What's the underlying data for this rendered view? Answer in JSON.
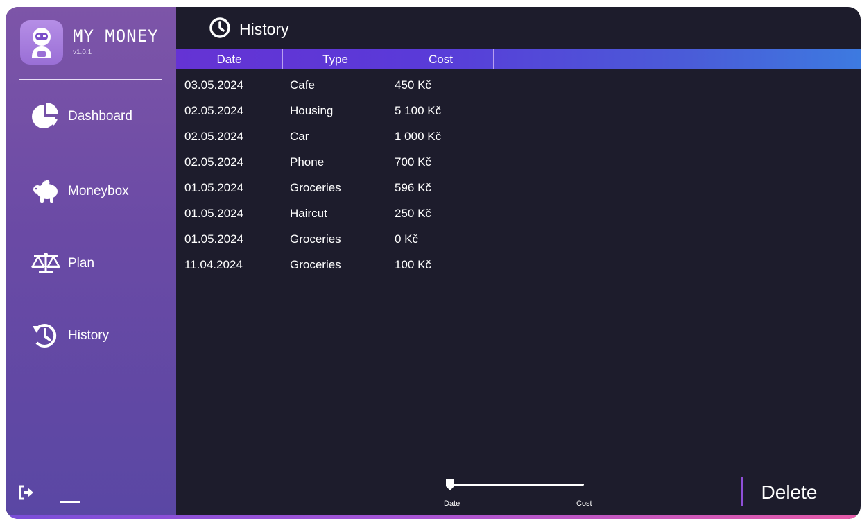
{
  "app": {
    "title": "MY MONEY",
    "version": "v1.0.1",
    "logo_icon": "robot-icon"
  },
  "sidebar": {
    "items": [
      {
        "label": "Dashboard",
        "icon": "pie-chart-icon"
      },
      {
        "label": "Moneybox",
        "icon": "piggy-bank-icon"
      },
      {
        "label": "Plan",
        "icon": "scale-icon"
      },
      {
        "label": "History",
        "icon": "history-icon"
      }
    ],
    "footer_icons": [
      "logout-icon",
      "minimize-icon"
    ]
  },
  "page": {
    "title": "History",
    "icon": "clock-icon"
  },
  "table": {
    "columns": [
      "Date",
      "Type",
      "Cost"
    ],
    "rows": [
      {
        "date": "03.05.2024",
        "type": "Cafe",
        "cost": "450 Kč"
      },
      {
        "date": "02.05.2024",
        "type": "Housing",
        "cost": "5 100 Kč"
      },
      {
        "date": "02.05.2024",
        "type": "Car",
        "cost": "1 000 Kč"
      },
      {
        "date": "02.05.2024",
        "type": "Phone",
        "cost": "700 Kč"
      },
      {
        "date": "01.05.2024",
        "type": "Groceries",
        "cost": "596 Kč"
      },
      {
        "date": "01.05.2024",
        "type": "Haircut",
        "cost": "250 Kč"
      },
      {
        "date": "01.05.2024",
        "type": "Groceries",
        "cost": "0 Kč"
      },
      {
        "date": "11.04.2024",
        "type": "Groceries",
        "cost": "100 Kč"
      }
    ]
  },
  "sort_slider": {
    "labels": [
      "Date",
      "Cost"
    ],
    "selected": "Date"
  },
  "actions": {
    "delete_label": "Delete"
  },
  "colors": {
    "background": "#1d1c2c",
    "sidebar_top": "#7d55a8",
    "sidebar_bottom": "#5a47a4",
    "header_start": "#6533d4",
    "header_end": "#3d7ae0",
    "accent_pink": "#e65aa8"
  }
}
